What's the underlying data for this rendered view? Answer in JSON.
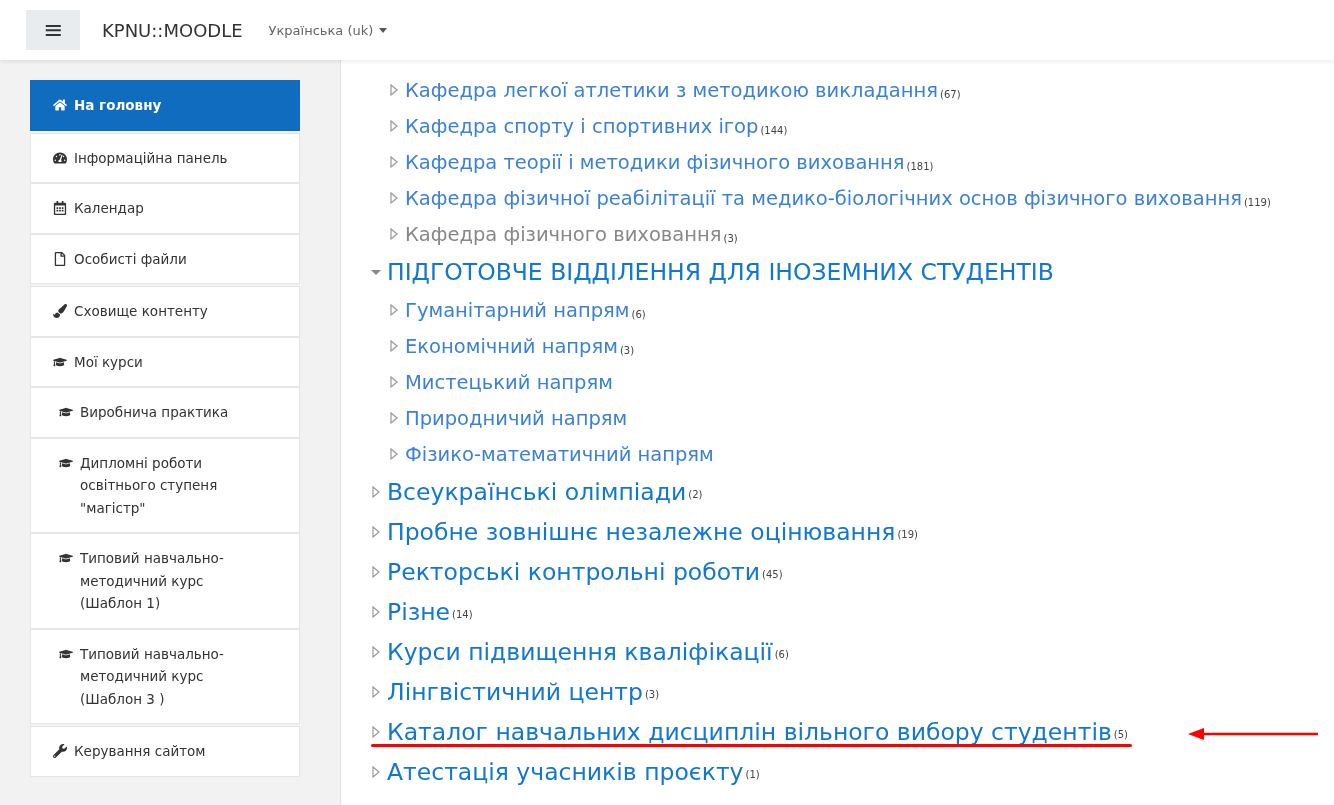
{
  "navbar": {
    "menu_button": "≡",
    "site_name": "KPNU::MOODLE",
    "language": "Українська (uk)"
  },
  "sidebar": {
    "groups": [
      [
        {
          "kind": "home",
          "label": "На головну",
          "selected": true
        }
      ],
      [
        {
          "kind": "dashboard",
          "label": "Інформаційна панель",
          "selected": false
        },
        {
          "kind": "calendar",
          "label": "Календар",
          "selected": false
        },
        {
          "kind": "file",
          "label": "Особисті файли",
          "selected": false
        }
      ],
      [
        {
          "kind": "content",
          "label": "Сховище контенту",
          "selected": false
        },
        {
          "kind": "courses",
          "label": "Мої курси",
          "selected": false
        },
        {
          "kind": "course",
          "label": "Виробнича практика",
          "selected": false
        },
        {
          "kind": "course",
          "label": "Дипломні роботи освітнього ступеня \"магістр\"",
          "selected": false
        },
        {
          "kind": "course",
          "label": "Типовий навчально-методичний курс (Шаблон 1)",
          "selected": false
        },
        {
          "kind": "course",
          "label": "Типовий навчально-методичний курс (Шаблон 3 )",
          "selected": false
        }
      ],
      [
        {
          "kind": "admin",
          "label": "Керування сайтом",
          "selected": false
        }
      ]
    ]
  },
  "categories": [
    {
      "children": [
        {
          "name": "Кафедра легкої атлетики з методикою викладання",
          "count": "(67)",
          "dimmed": false
        },
        {
          "name": "Кафедра спорту і спортивних ігор",
          "count": "(144)",
          "dimmed": false
        },
        {
          "name": "Кафедра теорії і методики фізичного виховання",
          "count": "(181)",
          "dimmed": false
        },
        {
          "name": "Кафедра фізичної реабілітації та медико-біологічних основ фізичного виховання",
          "count": "(119)",
          "dimmed": false
        },
        {
          "name": "Кафедра фізичного виховання",
          "count": "(3)",
          "dimmed": true
        }
      ]
    },
    {
      "name": "ПІДГОТОВЧЕ ВІДДІЛЕННЯ ДЛЯ ІНОЗЕМНИХ СТУДЕНТІВ",
      "expanded": true,
      "dimmed": false,
      "annotated": false,
      "children": [
        {
          "name": "Гуманітарний напрям",
          "count": "(6)",
          "dimmed": false
        },
        {
          "name": "Економічний напрям",
          "count": "(3)",
          "dimmed": false
        },
        {
          "name": "Мистецький напрям",
          "dimmed": false
        },
        {
          "name": "Природничий напрям",
          "dimmed": false
        },
        {
          "name": "Фізико-математичний напрям",
          "dimmed": false
        }
      ]
    },
    {
      "name": "Всеукраїнські олімпіади",
      "count": "(2)",
      "expanded": false,
      "dimmed": false,
      "annotated": false
    },
    {
      "name": "Пробне зовнішнє незалежне оцінювання",
      "count": "(19)",
      "expanded": false,
      "dimmed": false,
      "annotated": false
    },
    {
      "name": "Ректорські контрольні роботи",
      "count": "(45)",
      "expanded": false,
      "dimmed": false,
      "annotated": false
    },
    {
      "name": "Різне",
      "count": "(14)",
      "expanded": false,
      "dimmed": false,
      "annotated": false
    },
    {
      "name": "Курси підвищення кваліфікації",
      "count": "(6)",
      "expanded": false,
      "dimmed": false,
      "annotated": false
    },
    {
      "name": "Лінгвістичний центр",
      "count": "(3)",
      "expanded": false,
      "dimmed": false,
      "annotated": false
    },
    {
      "name": "Каталог навчальних дисциплін вільного вибору студентів",
      "count": "(5)",
      "expanded": false,
      "dimmed": false,
      "annotated": true
    },
    {
      "name": "Атестація учасників проєкту",
      "count": "(1)",
      "expanded": false,
      "dimmed": false,
      "annotated": false
    }
  ]
}
